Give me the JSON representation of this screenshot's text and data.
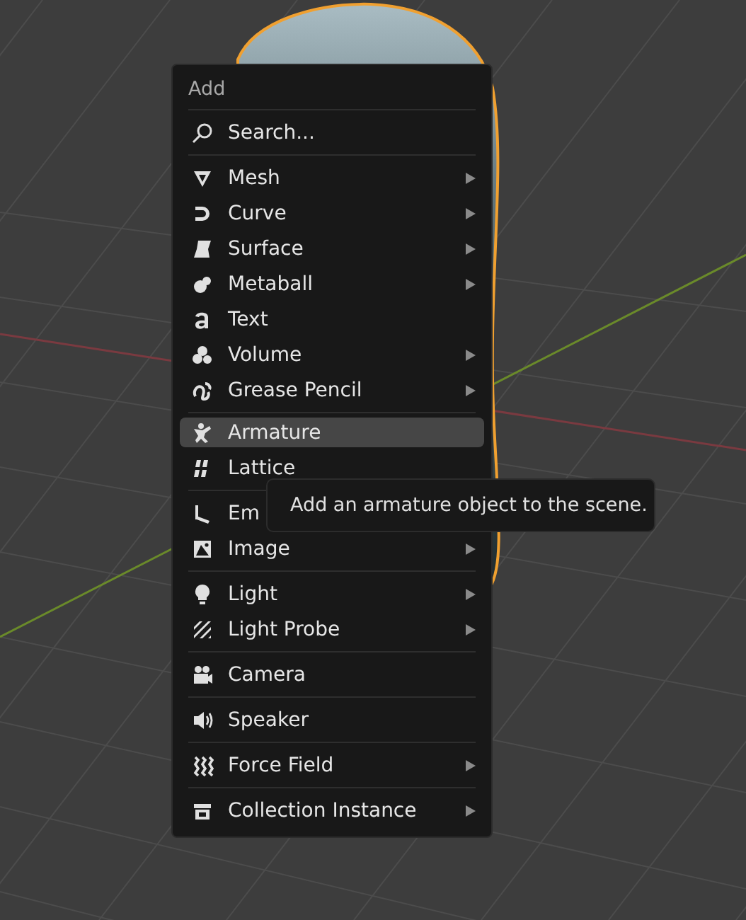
{
  "menu": {
    "title": "Add",
    "search": {
      "label": "Search..."
    },
    "sections": [
      [
        {
          "kind": "mesh",
          "label": "Mesh",
          "submenu": true,
          "selected": false
        },
        {
          "kind": "curve",
          "label": "Curve",
          "submenu": true,
          "selected": false
        },
        {
          "kind": "surface",
          "label": "Surface",
          "submenu": true,
          "selected": false
        },
        {
          "kind": "metaball",
          "label": "Metaball",
          "submenu": true,
          "selected": false
        },
        {
          "kind": "text",
          "label": "Text",
          "submenu": false,
          "selected": false
        },
        {
          "kind": "volume",
          "label": "Volume",
          "submenu": true,
          "selected": false
        },
        {
          "kind": "grease",
          "label": "Grease Pencil",
          "submenu": true,
          "selected": false
        }
      ],
      [
        {
          "kind": "armature",
          "label": "Armature",
          "submenu": false,
          "selected": true
        },
        {
          "kind": "lattice",
          "label": "Lattice",
          "submenu": false,
          "selected": false
        }
      ],
      [
        {
          "kind": "empty",
          "label": "Em",
          "selected": false
        },
        {
          "kind": "image",
          "label": "Image",
          "submenu": true,
          "selected": false
        }
      ],
      [
        {
          "kind": "light",
          "label": "Light",
          "submenu": true,
          "selected": false
        },
        {
          "kind": "probe",
          "label": "Light Probe",
          "submenu": true,
          "selected": false
        }
      ],
      [
        {
          "kind": "camera",
          "label": "Camera",
          "submenu": false,
          "selected": false
        }
      ],
      [
        {
          "kind": "speaker",
          "label": "Speaker",
          "submenu": false,
          "selected": false
        }
      ],
      [
        {
          "kind": "force",
          "label": "Force Field",
          "submenu": true,
          "selected": false
        }
      ],
      [
        {
          "kind": "collection",
          "label": "Collection Instance",
          "submenu": true,
          "selected": false
        }
      ]
    ]
  },
  "tooltip": {
    "text": "Add an armature object to the scene."
  }
}
